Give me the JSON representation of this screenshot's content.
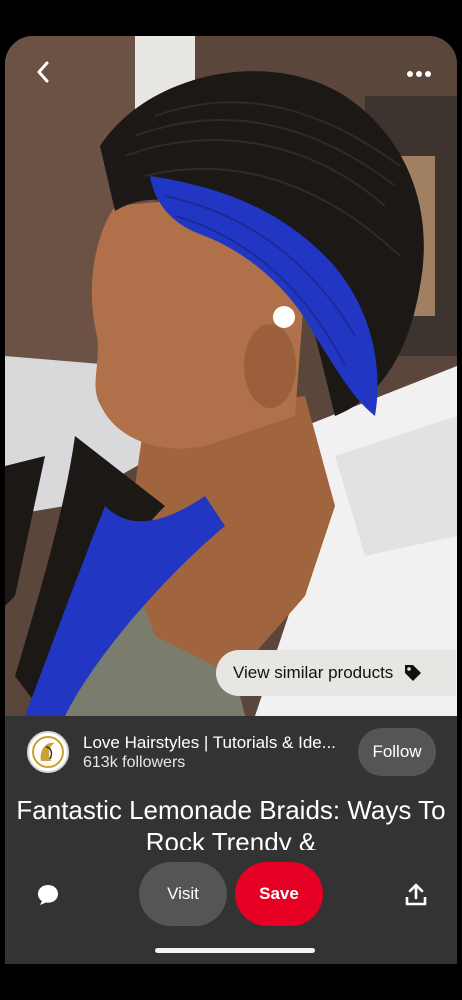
{
  "nav": {
    "back_icon": "chevron-left-icon",
    "more_icon": "more-horizontal-icon"
  },
  "image": {
    "alt": ""
  },
  "similar": {
    "label": "View similar products",
    "icon": "tag-icon"
  },
  "creator": {
    "name": "Love Hairstyles | Tutorials & Ide...",
    "followers": "613k followers",
    "follow_label": "Follow"
  },
  "pin": {
    "title": "Fantastic Lemonade Braids: Ways To Rock Trendy &"
  },
  "actions": {
    "comment_icon": "comment-icon",
    "visit_label": "Visit",
    "save_label": "Save",
    "share_icon": "share-icon"
  },
  "colors": {
    "save": "#e60023",
    "panel": "#333333",
    "secondary_button": "#555555"
  }
}
